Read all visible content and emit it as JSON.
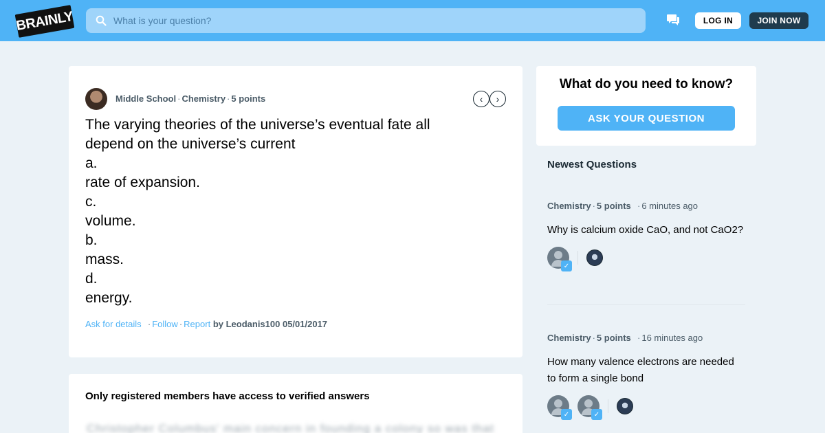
{
  "header": {
    "logo_text": "BRAINLY",
    "search_placeholder": "What is your question?",
    "login_label": "LOG IN",
    "join_label": "JOIN NOW"
  },
  "question": {
    "level": "Middle School",
    "subject": "Chemistry",
    "points": "5 points",
    "lines": [
      "The varying theories of the universe’s eventual fate all",
      "depend on the universe’s current",
      "a.",
      "rate of expansion.",
      "c.",
      "volume.",
      "b.",
      "mass.",
      "d.",
      "energy."
    ],
    "ask_details": "Ask for details",
    "follow": "Follow",
    "report": "Report",
    "byline": "by Leodanis100 05/01/2017"
  },
  "answers": {
    "title": "Only registered members have access to verified answers",
    "blurred": "Christopher Columbus' main concern in founding a colony so was that"
  },
  "ask": {
    "title": "What do you need to know?",
    "button": "ASK YOUR QUESTION"
  },
  "newest": {
    "title": "Newest Questions",
    "items": [
      {
        "subject": "Chemistry",
        "points": "5 points",
        "time": "6 minutes ago",
        "text": "Why is calcium oxide CaO, and not CaO2?"
      },
      {
        "subject": "Chemistry",
        "points": "5 points",
        "time": "16 minutes ago",
        "text": "How many valence electrons are needed to form a single bond"
      }
    ]
  },
  "colors": {
    "brand_blue": "#4fb3f6",
    "dark_navy": "#1f3b4d",
    "background": "#ebf2f7"
  }
}
